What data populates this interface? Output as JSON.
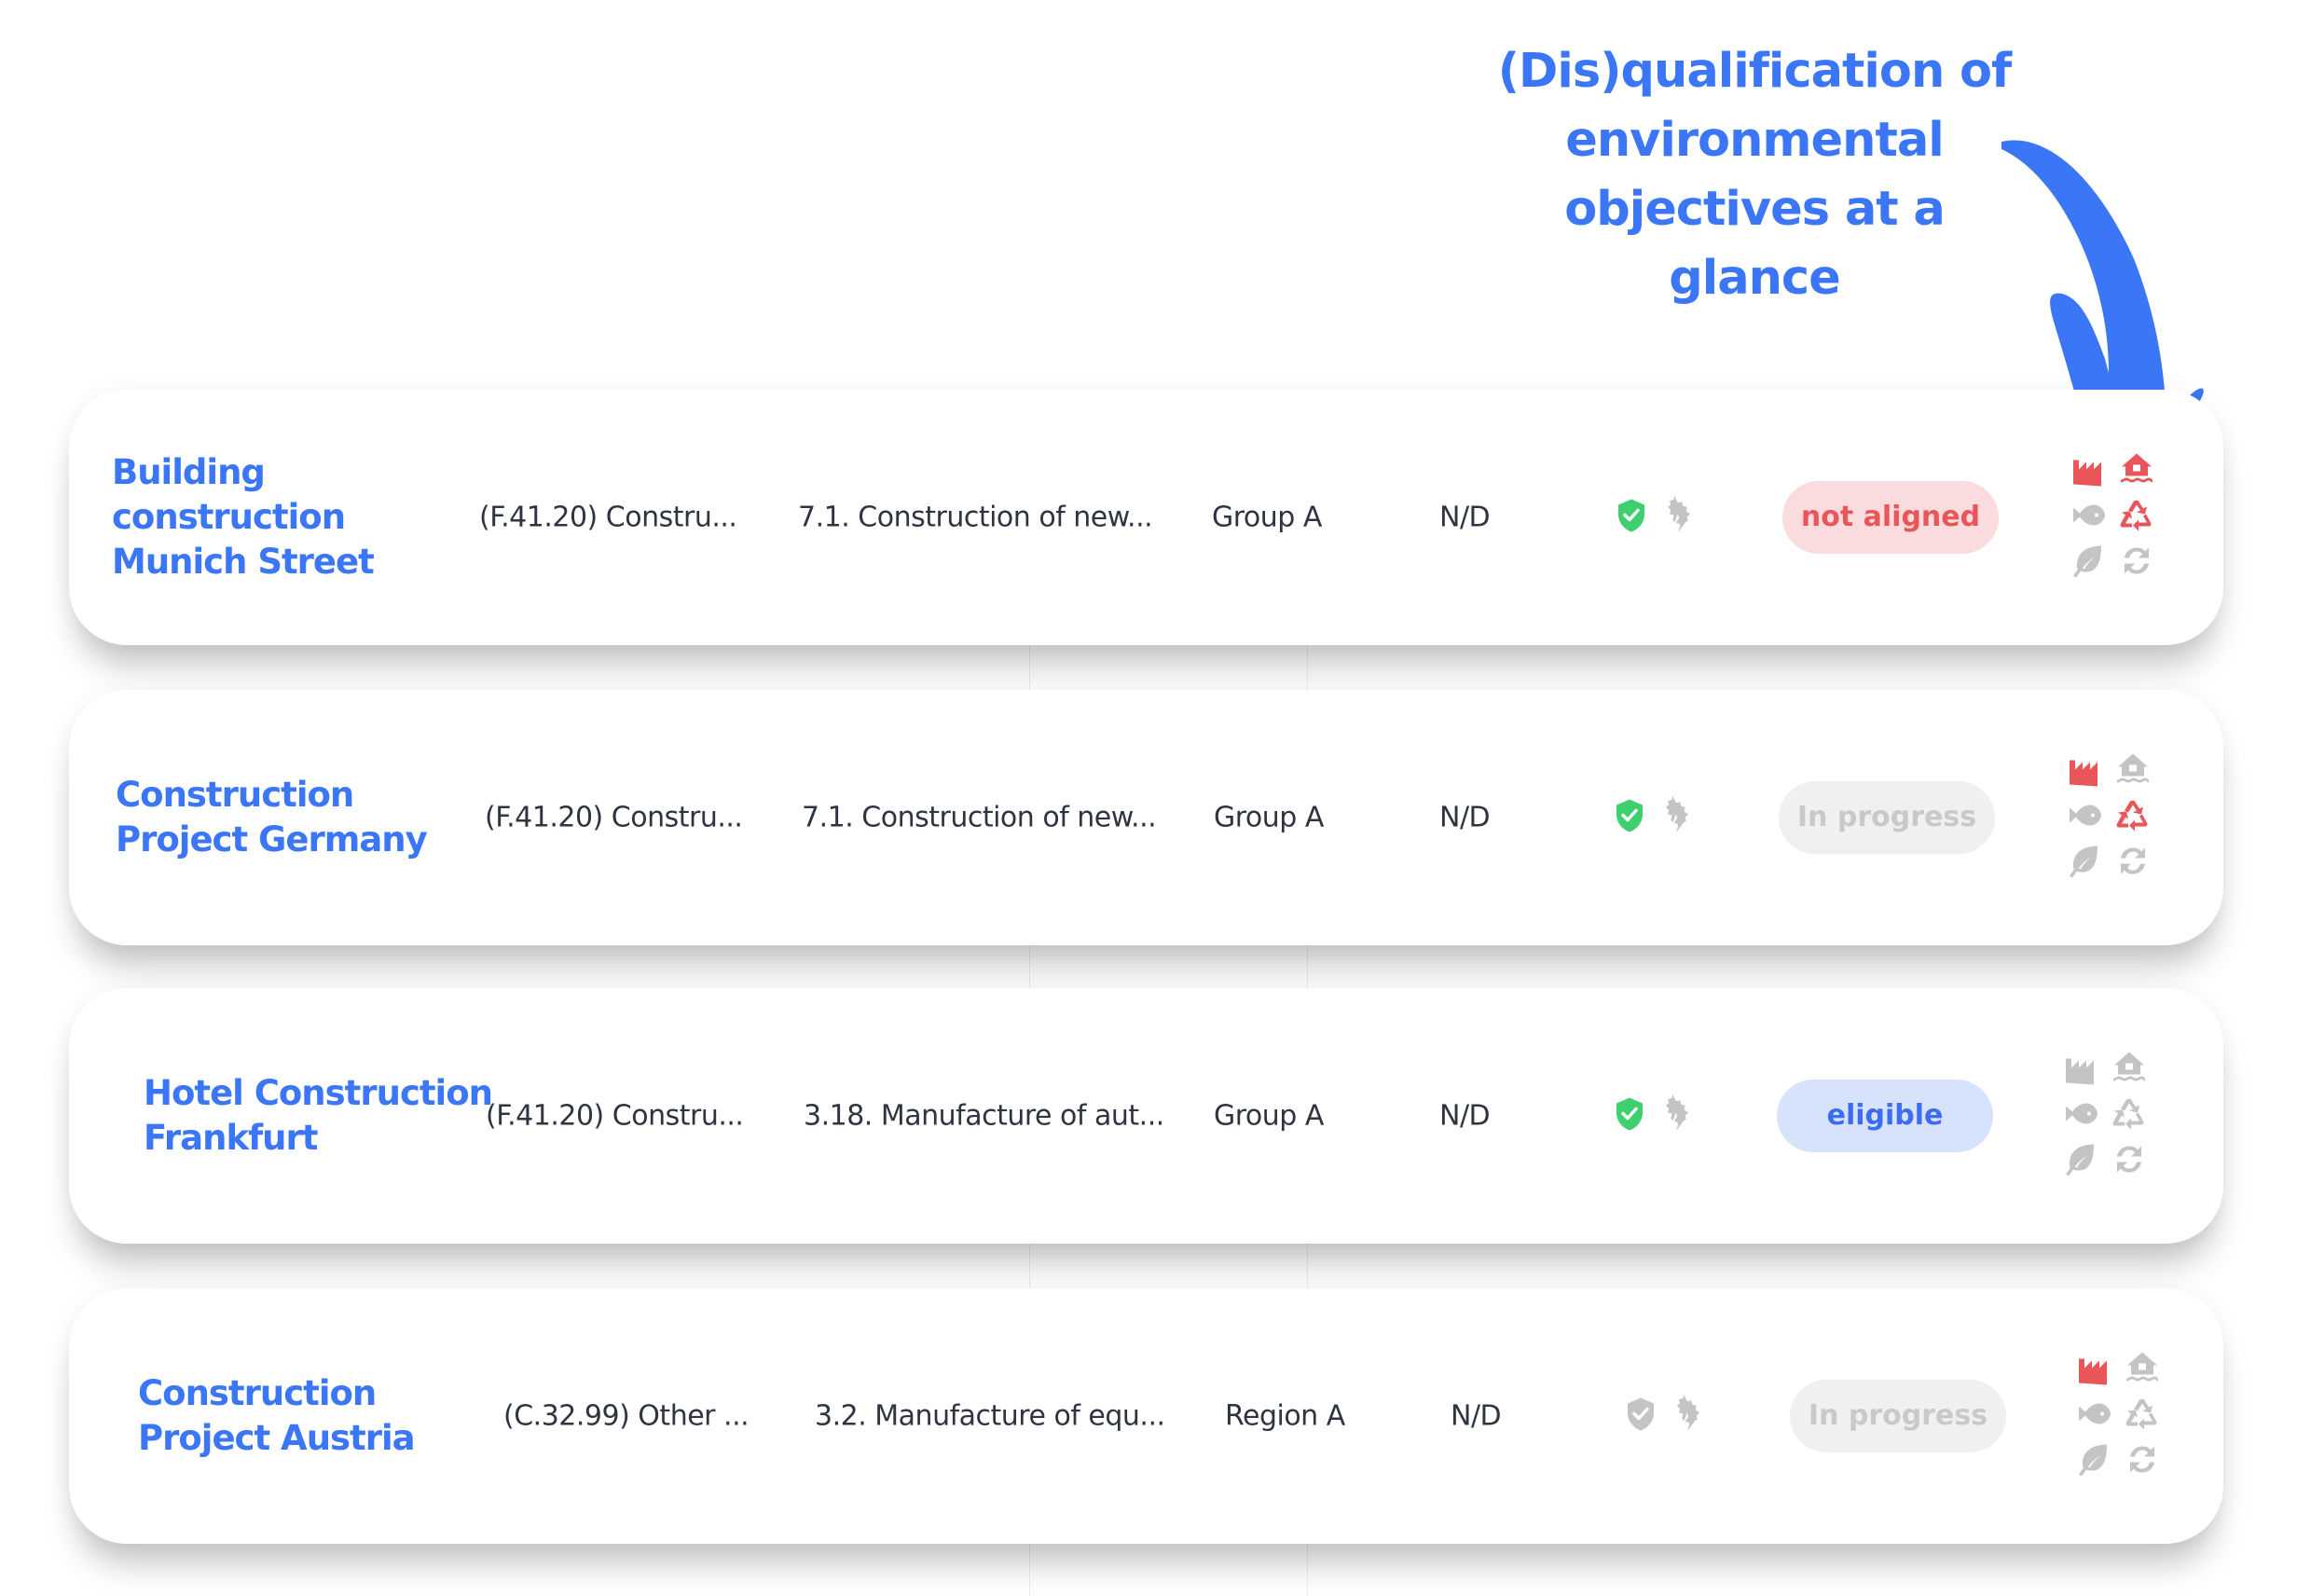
{
  "annotation": {
    "lines": [
      "(Dis)qualification of",
      "environmental",
      "objectives at a glance"
    ],
    "color": "#3b76f6"
  },
  "colors": {
    "accent": "#3b76f6",
    "red": "#e8565a",
    "gray_icon": "#c4c4c4",
    "green": "#3ecf6e"
  },
  "rows": [
    {
      "name": "Building construction Munich Street",
      "nace": "(F.41.20) Constru...",
      "activity": "7.1. Construction of new...",
      "group": "Group A",
      "value": "N/D",
      "safeguard": "ok",
      "status": {
        "label": "not aligned",
        "variant": "red"
      },
      "objectives": {
        "pollution": "red",
        "adaptation": "red",
        "water": "gray",
        "circular": "red",
        "biodiversity": "gray",
        "mitigation": "gray"
      }
    },
    {
      "name": "Construction Project Germany",
      "nace": "(F.41.20) Constru...",
      "activity": "7.1. Construction of new...",
      "group": "Group A",
      "value": "N/D",
      "safeguard": "ok",
      "status": {
        "label": "In progress",
        "variant": "gray"
      },
      "objectives": {
        "pollution": "red",
        "adaptation": "gray",
        "water": "gray",
        "circular": "red",
        "biodiversity": "gray",
        "mitigation": "gray"
      }
    },
    {
      "name": "Hotel Construction Frankfurt",
      "nace": "(F.41.20) Constru...",
      "activity": "3.18. Manufacture of aut...",
      "group": "Group A",
      "value": "N/D",
      "safeguard": "ok",
      "status": {
        "label": "eligible",
        "variant": "blue"
      },
      "objectives": {
        "pollution": "gray",
        "adaptation": "gray",
        "water": "gray",
        "circular": "gray",
        "biodiversity": "gray",
        "mitigation": "gray"
      }
    },
    {
      "name": "Construction Project Austria",
      "nace": "(C.32.99) Other ...",
      "activity": "3.2. Manufacture of equ...",
      "group": "Region A",
      "value": "N/D",
      "safeguard": "gray",
      "status": {
        "label": "In progress",
        "variant": "gray"
      },
      "objectives": {
        "pollution": "red",
        "adaptation": "gray",
        "water": "gray",
        "circular": "gray",
        "biodiversity": "gray",
        "mitigation": "gray"
      }
    }
  ]
}
